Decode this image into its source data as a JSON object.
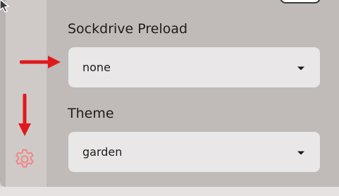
{
  "settings": {
    "sockdrive": {
      "label": "Sockdrive Preload",
      "value": "none"
    },
    "theme": {
      "label": "Theme",
      "value": "garden"
    }
  },
  "icons": {
    "settings": "gear-icon",
    "annotation": "red-arrow-icon"
  },
  "colors": {
    "panel_bg": "#c0bab8",
    "sidebar_bg": "#cfcac8",
    "select_bg": "#e9e7e7",
    "annotation_red": "#e0191b",
    "gear_pink": "#f08a8a"
  }
}
